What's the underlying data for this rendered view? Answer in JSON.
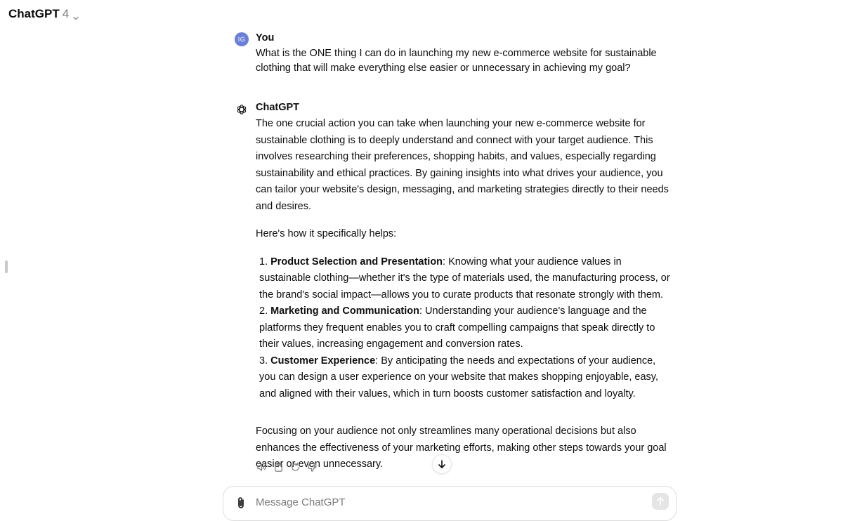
{
  "header": {
    "model_name": "ChatGPT",
    "model_version": "4"
  },
  "user_message": {
    "avatar_initials": "IG",
    "avatar_color": "#6a7fd8",
    "author": "You",
    "text": "What is the ONE thing I can do in launching my new e-commerce website for sustainable clothing that will make everything else easier or unnecessary in achieving my goal?"
  },
  "assistant_message": {
    "author": "ChatGPT",
    "intro": "The one crucial action you can take when launching your new e-commerce website for sustainable clothing is to deeply understand and connect with your target audience. This involves researching their preferences, shopping habits, and values, especially regarding sustainability and ethical practices. By gaining insights into what drives your audience, you can tailor your website's design, messaging, and marketing strategies directly to their needs and desires.",
    "lead": "Here's how it specifically helps:",
    "list": [
      {
        "num": "1.",
        "title": "Product Selection and Presentation",
        "text": ": Knowing what your audience values in sustainable clothing—whether it's the type of materials used, the manufacturing process, or the brand's social impact—allows you to curate products that resonate strongly with them."
      },
      {
        "num": "2.",
        "title": "Marketing and Communication",
        "text": ": Understanding your audience's language and the platforms they frequent enables you to craft compelling campaigns that speak directly to their values, increasing engagement and conversion rates."
      },
      {
        "num": "3.",
        "title": "Customer Experience",
        "text": ": By anticipating the needs and expectations of your audience, you can design a user experience on your website that makes shopping enjoyable, easy, and aligned with their values, which in turn boosts customer satisfaction and loyalty."
      }
    ],
    "conclusion": "Focusing on your audience not only streamlines many operational decisions but also enhances the effectiveness of your marketing efforts, making other steps towards your goal easier or even unnecessary."
  },
  "message_actions": [
    "speaker-icon",
    "copy-icon",
    "regenerate-icon",
    "thumbs-down-icon"
  ],
  "composer": {
    "placeholder": "Message ChatGPT"
  }
}
